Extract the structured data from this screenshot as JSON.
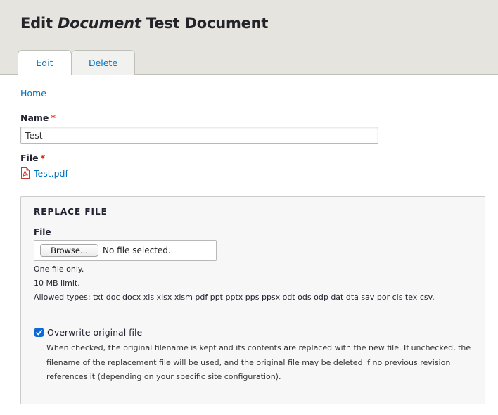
{
  "header": {
    "title_prefix": "Edit",
    "title_type": "Document",
    "title_name": "Test Document"
  },
  "tabs": [
    {
      "label": "Edit",
      "active": true
    },
    {
      "label": "Delete",
      "active": false
    }
  ],
  "breadcrumb": {
    "home": "Home"
  },
  "form": {
    "name_label": "Name",
    "name_required": "*",
    "name_value": "Test",
    "file_label": "File",
    "file_required": "*",
    "file_link": "Test.pdf",
    "file_icon": "pdf-icon"
  },
  "replace_file": {
    "legend": "REPLACE FILE",
    "file_label": "File",
    "browse_label": "Browse...",
    "no_file_text": "No file selected.",
    "desc_one": "One file only.",
    "desc_limit": "10 MB limit.",
    "desc_types": "Allowed types: txt doc docx xls xlsx xlsm pdf ppt pptx pps ppsx odt ods odp dat dta sav por cls tex csv.",
    "overwrite_label": "Overwrite original file",
    "overwrite_checked": true,
    "overwrite_desc": "When checked, the original filename is kept and its contents are replaced with the new file. If unchecked, the filename of the replacement file will be used, and the original file may be deleted if no previous revision references it (depending on your specific site configuration)."
  },
  "colors": {
    "link": "#0074bd",
    "required": "#e32700",
    "header_bg": "#e6e4df",
    "checkbox": "#0a6ad6"
  }
}
